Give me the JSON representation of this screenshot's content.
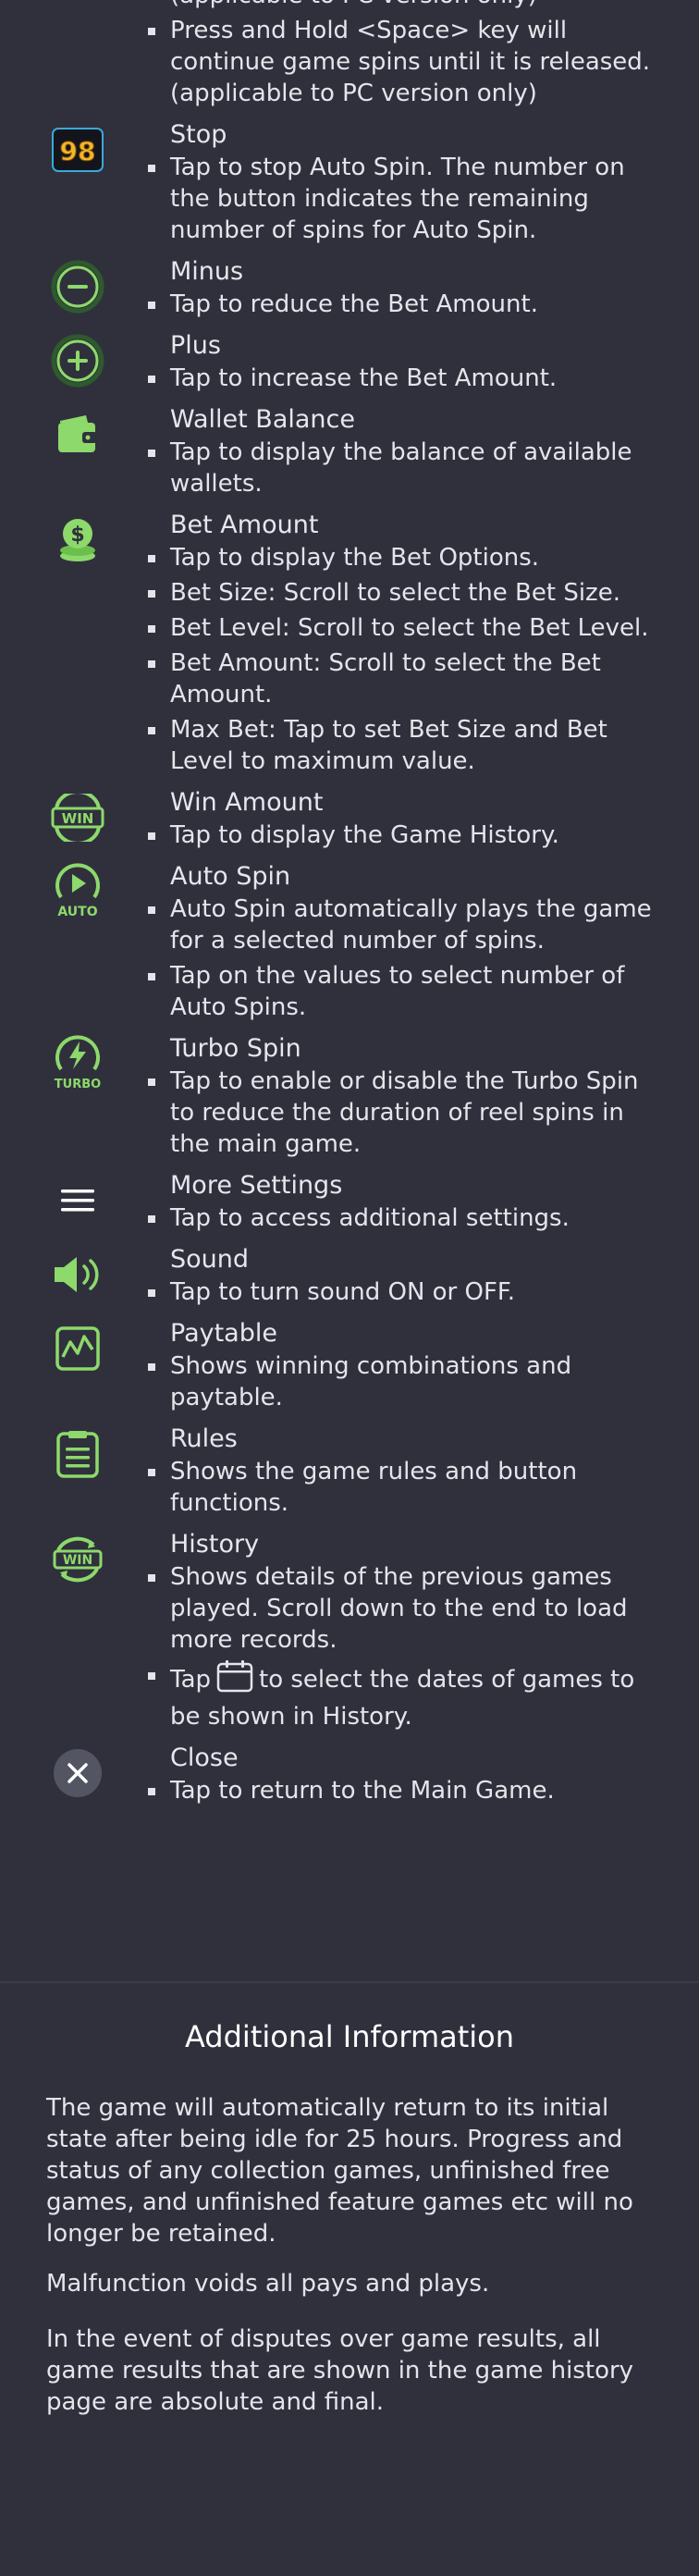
{
  "colors": {
    "background": "#30303d",
    "icon_green": "#8dd96b",
    "text": "#e4e4ea"
  },
  "controls": [
    {
      "icon": "space-key-hold",
      "title": "",
      "bullets": [
        "(applicable to PC version only)",
        "Press and Hold <Space> key will continue game spins until it is released. (applicable to PC version only)"
      ]
    },
    {
      "icon": "stop-98-icon",
      "icon_text": "98",
      "title": "Stop",
      "bullets": [
        "Tap to stop Auto Spin. The number on the button indicates the remaining number of spins for Auto Spin."
      ]
    },
    {
      "icon": "minus-icon",
      "title": "Minus",
      "bullets": [
        "Tap to reduce the Bet Amount."
      ]
    },
    {
      "icon": "plus-icon",
      "title": "Plus",
      "bullets": [
        "Tap to increase the Bet Amount."
      ]
    },
    {
      "icon": "wallet-icon",
      "title": "Wallet Balance",
      "bullets": [
        "Tap to display the balance of available wallets."
      ]
    },
    {
      "icon": "coins-icon",
      "title": "Bet Amount",
      "bullets": [
        "Tap to display the Bet Options.",
        "Bet Size: Scroll to select the Bet Size.",
        "Bet Level: Scroll to select the Bet Level.",
        "Bet Amount: Scroll to select the Bet Amount.",
        "Max Bet: Tap to set Bet Size and Bet Level to maximum value."
      ]
    },
    {
      "icon": "win-icon",
      "icon_text": "WIN",
      "title": "Win Amount",
      "bullets": [
        "Tap to display the Game History."
      ]
    },
    {
      "icon": "auto-spin-icon",
      "icon_text": "AUTO",
      "title": "Auto Spin",
      "bullets": [
        "Auto Spin automatically plays the game for a selected number of spins.",
        "Tap on the values to select number of Auto Spins."
      ]
    },
    {
      "icon": "turbo-spin-icon",
      "icon_text": "TURBO",
      "title": "Turbo Spin",
      "bullets": [
        "Tap to enable or disable the Turbo Spin to reduce the duration of reel spins in the main game."
      ]
    },
    {
      "icon": "menu-icon",
      "title": "More Settings",
      "bullets": [
        "Tap to access additional settings."
      ]
    },
    {
      "icon": "sound-icon",
      "title": "Sound",
      "bullets": [
        "Tap to turn sound ON or OFF."
      ]
    },
    {
      "icon": "paytable-icon",
      "title": "Paytable",
      "bullets": [
        "Shows winning combinations and paytable."
      ]
    },
    {
      "icon": "rules-icon",
      "title": "Rules",
      "bullets": [
        "Shows the game rules and button functions."
      ]
    },
    {
      "icon": "history-icon",
      "icon_text": "WIN",
      "title": "History",
      "bullets": [
        "Shows details of the previous games played. Scroll down to the end to load more records."
      ],
      "calendar_bullet": {
        "before": "Tap",
        "after": "to select the dates of games to be shown in History."
      }
    },
    {
      "icon": "close-icon",
      "title": "Close",
      "bullets": [
        "Tap to return to the Main Game."
      ]
    }
  ],
  "additional": {
    "title": "Additional Information",
    "paragraphs": [
      "The game will automatically return to its initial state after being idle for 25 hours. Progress and status of any collection games, unfinished free games, and unfinished feature games etc will no longer be retained.",
      "Malfunction voids all pays and plays.",
      "In the event of disputes over game results, all game results that are shown in the game history page are absolute and final."
    ]
  }
}
